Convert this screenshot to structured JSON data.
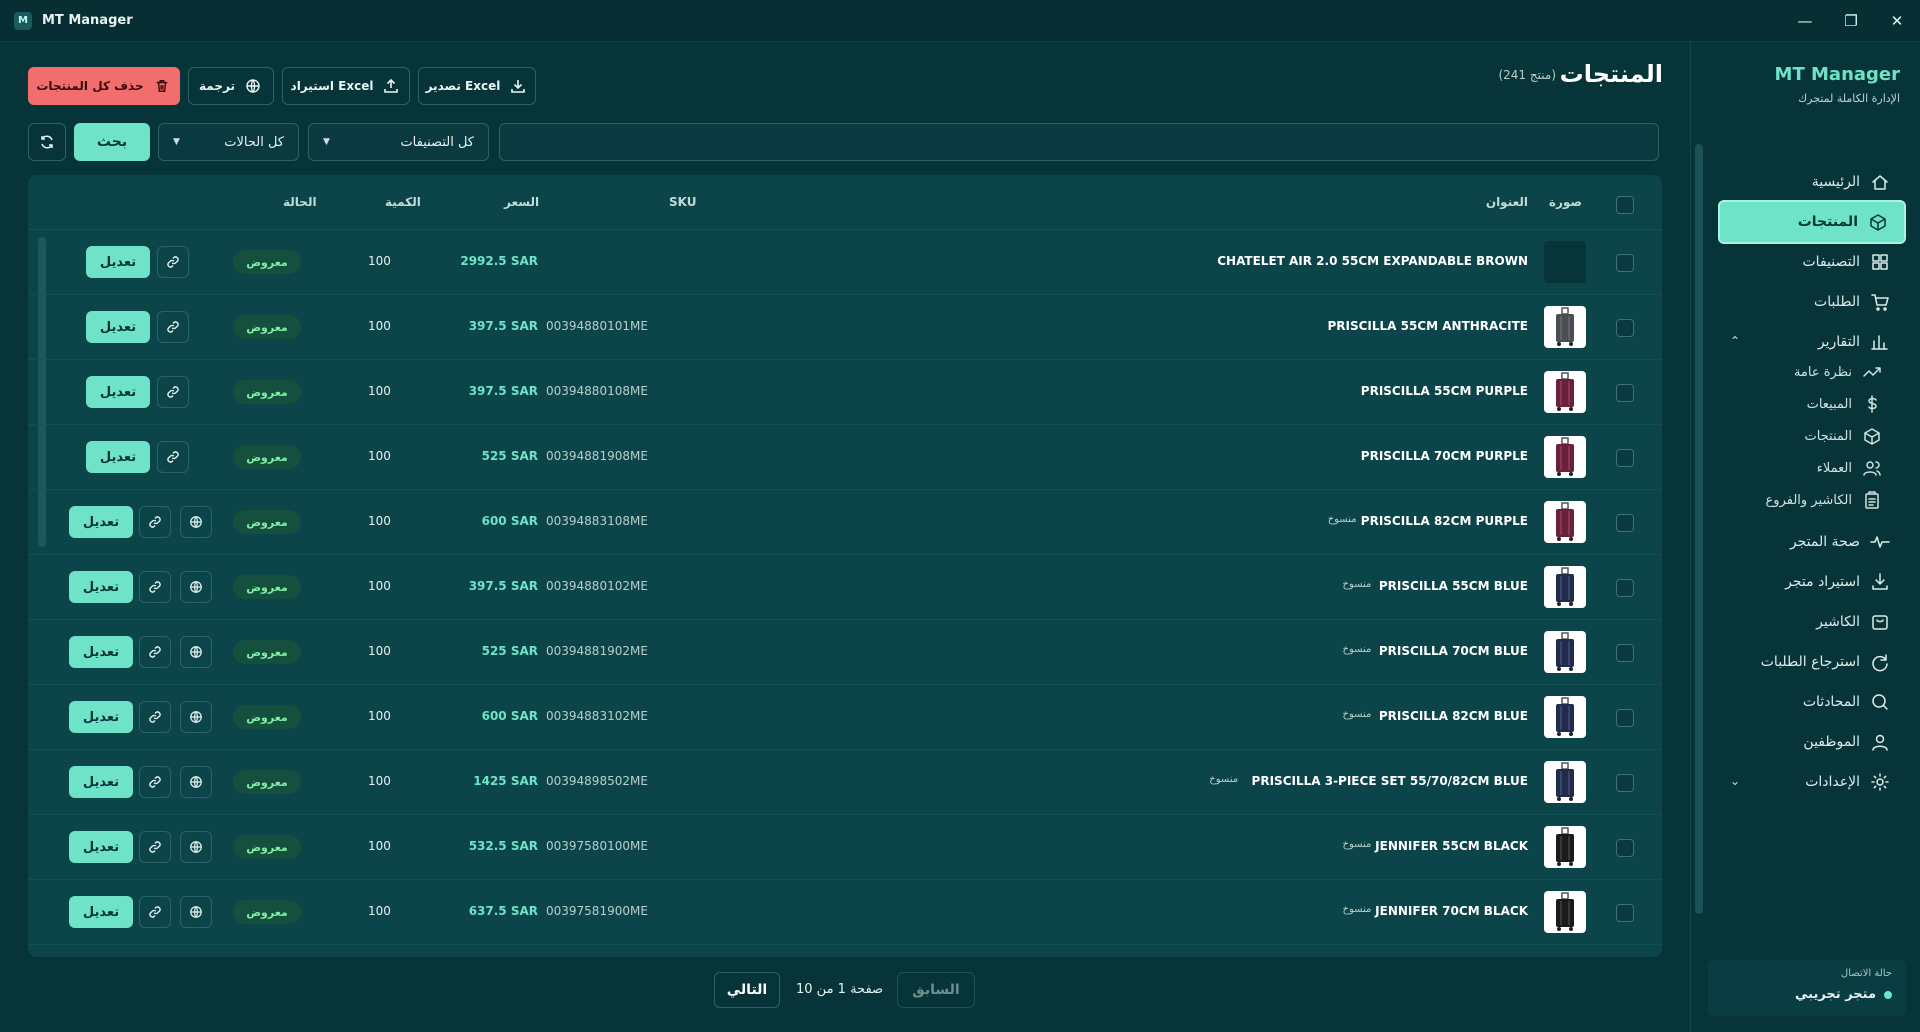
{
  "window": {
    "title": "MT Manager",
    "logo_letter": "M"
  },
  "sidebar": {
    "brand_name": "MT Manager",
    "brand_sub": "الإدارة الكاملة لمتجرك",
    "items": [
      {
        "label": "الرئيسية",
        "icon": "home-icon"
      },
      {
        "label": "المنتجات",
        "icon": "box-icon",
        "active": true
      },
      {
        "label": "التصنيفات",
        "icon": "grid-icon"
      },
      {
        "label": "الطلبات",
        "icon": "cart-icon"
      },
      {
        "label": "التقارير",
        "icon": "bar-chart-icon",
        "expanded": true
      },
      {
        "label": "نظرة عامة",
        "icon": "trend-icon",
        "sub": true
      },
      {
        "label": "المبيعات",
        "icon": "dollar-icon",
        "sub": true
      },
      {
        "label": "المنتجات",
        "icon": "box-icon",
        "sub": true
      },
      {
        "label": "العملاء",
        "icon": "users-icon",
        "sub": true
      },
      {
        "label": "الكاشير والفروع",
        "icon": "clipboard-icon",
        "sub": true
      },
      {
        "label": "صحة المتجر",
        "icon": "pulse-icon"
      },
      {
        "label": "استيراد متجر",
        "icon": "download-icon"
      },
      {
        "label": "الكاشير",
        "icon": "register-icon"
      },
      {
        "label": "استرجاع الطلبات",
        "icon": "refresh-icon"
      },
      {
        "label": "المحادثات",
        "icon": "chat-icon"
      },
      {
        "label": "الموظفين",
        "icon": "staff-icon"
      },
      {
        "label": "الإعدادات",
        "icon": "gear-icon",
        "collapsible": true
      }
    ],
    "connection_label": "حالة الاتصال",
    "connection_value": "متجر تجريبي"
  },
  "header": {
    "title": "المنتجات",
    "count": "(241 منتج)",
    "export_label": "تصدير Excel",
    "import_label": "استيراد Excel",
    "translate_label": "ترجمة",
    "delete_all_label": "حذف كل المنتجات"
  },
  "filters": {
    "search_placeholder": "",
    "category_value": "كل التصنيفات",
    "status_value": "كل الحالات",
    "search_button": "بحث"
  },
  "table": {
    "columns": {
      "image": "صورة",
      "title": "العنوان",
      "sku": "SKU",
      "price": "السعر",
      "qty": "الكمية",
      "status": "الحالة"
    },
    "edit_label": "تعديل",
    "rows": [
      {
        "title": "CHATELET AIR 2.0 55CM EXPANDABLE BROWN",
        "tag": "",
        "sku": "",
        "price": "2992.5 SAR",
        "qty": "100",
        "status": "معروض",
        "color": "",
        "translated": false
      },
      {
        "title": "PRISCILLA 55CM ANTHRACITE",
        "tag": "",
        "sku": "00394880101ME",
        "price": "397.5 SAR",
        "qty": "100",
        "status": "معروض",
        "color": "#4a4d52",
        "translated": false
      },
      {
        "title": "PRISCILLA 55CM PURPLE",
        "tag": "",
        "sku": "00394880108ME",
        "price": "397.5 SAR",
        "qty": "100",
        "status": "معروض",
        "color": "#6b1f3a",
        "translated": false
      },
      {
        "title": "PRISCILLA 70CM PURPLE",
        "tag": "",
        "sku": "00394881908ME",
        "price": "525 SAR",
        "qty": "100",
        "status": "معروض",
        "color": "#6b1f3a",
        "translated": false
      },
      {
        "title": "PRISCILLA 82CM PURPLE",
        "tag": "منسوخ",
        "sku": "00394883108ME",
        "price": "600 SAR",
        "qty": "100",
        "status": "معروض",
        "color": "#6b1f3a",
        "translated": true
      },
      {
        "title": "PRISCILLA 55CM BLUE",
        "tag": "منسوخ",
        "sku": "00394880102ME",
        "price": "397.5 SAR",
        "qty": "100",
        "status": "معروض",
        "color": "#1f2c4e",
        "translated": true
      },
      {
        "title": "PRISCILLA 70CM BLUE",
        "tag": "منسوخ",
        "sku": "00394881902ME",
        "price": "525 SAR",
        "qty": "100",
        "status": "معروض",
        "color": "#1f2c4e",
        "translated": true
      },
      {
        "title": "PRISCILLA 82CM BLUE",
        "tag": "منسوخ",
        "sku": "00394883102ME",
        "price": "600 SAR",
        "qty": "100",
        "status": "معروض",
        "color": "#1f2c4e",
        "translated": true
      },
      {
        "title": "PRISCILLA 3-PIECE SET 55/70/82CM BLUE",
        "tag": "منسوخ",
        "sku": "00394898502ME",
        "price": "1425 SAR",
        "qty": "100",
        "status": "معروض",
        "color": "#1f2c4e",
        "translated": true
      },
      {
        "title": "JENNIFER 55CM BLACK",
        "tag": "منسوخ",
        "sku": "00397580100ME",
        "price": "532.5 SAR",
        "qty": "100",
        "status": "معروض",
        "color": "#1b1b1d",
        "translated": true
      },
      {
        "title": "JENNIFER 70CM BLACK",
        "tag": "منسوخ",
        "sku": "00397581900ME",
        "price": "637.5 SAR",
        "qty": "100",
        "status": "معروض",
        "color": "#1b1b1d",
        "translated": true
      }
    ]
  },
  "pagination": {
    "prev": "السابق",
    "info": "صفحة 1 من 10",
    "next": "التالي"
  }
}
